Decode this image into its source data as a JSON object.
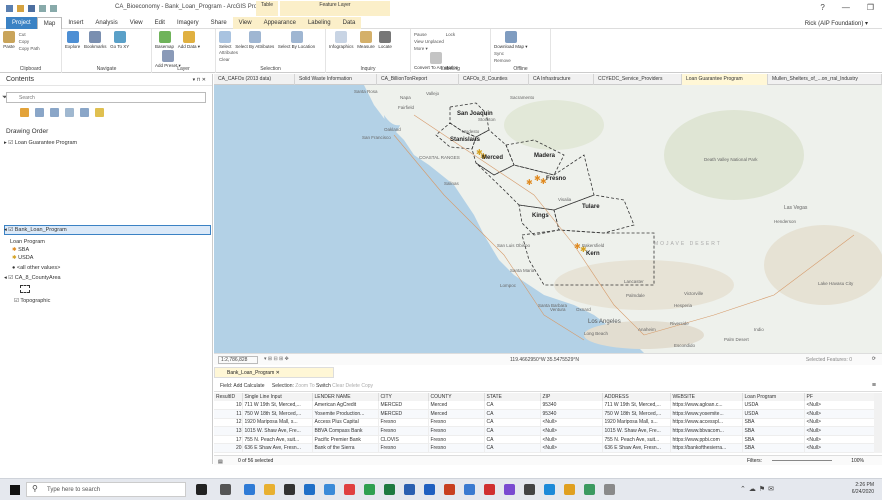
{
  "window": {
    "title": "CA_Bioeconomy - Bank_Loan_Program - ArcGIS Pro",
    "context_table": "Table",
    "context_feature": "Feature Layer",
    "help": "?",
    "minimize": "—",
    "restore": "❐",
    "user": "Rick (AIP Foundation) ▾"
  },
  "ribbon_tabs": [
    "Project",
    "Map",
    "Insert",
    "Analysis",
    "View",
    "Edit",
    "Imagery",
    "Share",
    "View",
    "Appearance",
    "Labeling",
    "Data"
  ],
  "ribbon_groups": [
    {
      "label": "Clipboard",
      "items": [
        "Cut",
        "Copy",
        "Copy Path"
      ],
      "paste": "Paste"
    },
    {
      "label": "Navigate",
      "items": [
        "Explore",
        "Bookmarks",
        "Go To XY"
      ]
    },
    {
      "label": "Layer",
      "items": [
        "Basemap",
        "Add Data ▾",
        "Add Preset ▾"
      ]
    },
    {
      "label": "Selection",
      "items": [
        "Select",
        "Select By Attributes",
        "Select By Location",
        "Attributes",
        "Clear"
      ]
    },
    {
      "label": "Inquiry",
      "items": [
        "Infographics",
        "Measure",
        "Locate"
      ]
    },
    {
      "label": "Labeling",
      "items": [
        "Pause",
        "Lock",
        "View Unplaced",
        "More ▾",
        "Convert To Annotation"
      ]
    },
    {
      "label": "Offline",
      "items": [
        "Download Map ▾",
        "Sync",
        "Remove"
      ]
    }
  ],
  "contents": {
    "header": "Contents",
    "pin": "▾ ⊓ ✕",
    "search_placeholder": "Search",
    "drawing_order": "Drawing Order",
    "layers": {
      "loan_guarantee": "Loan Guarantee Program",
      "bank_loan": "Bank_Loan_Program",
      "loan_program": "Loan Program",
      "sba": "SBA",
      "usda": "USDA",
      "other": "<all other values>",
      "county": "CA_8_CountyArea",
      "topographic": "Topographic"
    }
  },
  "map_tabs": [
    "CA_CAFOs (2013 data)",
    "Solid Waste Information",
    "CA_BillionTonReport",
    "CAFOs_8_Counties",
    "CA Infrastructure",
    "CCYEDC_Service_Providers",
    "Loan Guarantee Program",
    "Mullen_Shelters_of_...on_rral_Industry"
  ],
  "map_labels": {
    "counties": [
      "San Joaquin",
      "Stanislaus",
      "Merced",
      "Madera",
      "Fresno",
      "Tulare",
      "Kings",
      "Kern"
    ],
    "places": [
      "Santa Rosa",
      "Napa",
      "Vallejo",
      "Fairfield",
      "Sacramento",
      "Stockton",
      "Oakland",
      "San Francisco",
      "Modesto",
      "COASTAL RANGES",
      "Salinas",
      "Visalia",
      "San Luis Obispo",
      "Bakersfield",
      "Santa Maria",
      "Lompoc",
      "Santa Barbara",
      "Oxnard",
      "Los Angeles",
      "Long Beach",
      "Anaheim",
      "Riverside",
      "Palm Desert",
      "Palmdale",
      "Lancaster",
      "Victorville",
      "Las Vegas",
      "Henderson",
      "Lake Havasu City",
      "Hesperia",
      "MOJAVE DESERT",
      "Death Valley National Park",
      "Ventura",
      "Indio",
      "Escondido"
    ]
  },
  "map_status": {
    "scale": "1:2,786,828",
    "coordinates": "119.4662950°W 35.5475529°N",
    "selected_features": "Selected Features: 0"
  },
  "attribute": {
    "tab": "Bank_Loan_Program ✕",
    "field_label": "Field:",
    "add": "Add",
    "calculate": "Calculate",
    "selection_label": "Selection:",
    "zoom_to": "Zoom To",
    "switch": "Switch",
    "clear": "Clear",
    "delete": "Delete",
    "copy": "Copy",
    "columns": [
      "ResultID",
      "Single Line Input",
      "LENDER NAME",
      "CITY",
      "COUNTY",
      "STATE",
      "ZIP",
      "ADDRESS",
      "WEBSITE",
      "Loan Program",
      "PF"
    ],
    "rows": [
      [
        "10",
        "711 W 19th St, Merced,...",
        "American AgCredit",
        "MERCED",
        "Merced",
        "CA",
        "95340",
        "711 W 19th St, Merced,...",
        "https://www.agloan.c...",
        "USDA",
        "<Null>"
      ],
      [
        "11",
        "750 W 18th St, Merced,...",
        "Yosemite Production...",
        "MERCED",
        "Merced",
        "CA",
        "95340",
        "750 W 18th St, Merced,...",
        "https://www.yosemite...",
        "USDA",
        "<Null>"
      ],
      [
        "12",
        "1920 Mariposa Mall, s...",
        "Access Plus Capital",
        "Fresno",
        "Fresno",
        "CA",
        "<Null>",
        "1920 Mariposa Mall, s...",
        "https://www.accesspl...",
        "SBA",
        "<Null>"
      ],
      [
        "13",
        "1015 W. Shaw Ave, Fre...",
        "BBVA Compass Bank",
        "Fresno",
        "Fresno",
        "CA",
        "<Null>",
        "1015 W. Shaw Ave, Fre...",
        "https://www.bbvacom...",
        "SBA",
        "<Null>"
      ],
      [
        "17",
        "755 N. Peach Ave, suit...",
        "Pacific Premier Bank",
        "CLOVIS",
        "Fresno",
        "CA",
        "<Null>",
        "755 N. Peach Ave, suit...",
        "https://www.ppbi.com",
        "SBA",
        "<Null>"
      ],
      [
        "20",
        "636 E Shaw Ave, Fresn...",
        "Bank of the Sierra",
        "Fresno",
        "Fresno",
        "CA",
        "<Null>",
        "636 E Shaw Ave, Fresn...",
        "https://bankofthesierra...",
        "SBA",
        "<Null>"
      ]
    ],
    "footer": "0 of 56 selected",
    "filters": "Filters:",
    "zoom": "100%"
  },
  "taskbar": {
    "search_placeholder": "Type here to search",
    "time": "2:26 PM",
    "date": "6/24/2020"
  },
  "colors": {
    "project_tab": "#3b82c4",
    "context_tab": "#fbefc9",
    "map_land": "#eef1ec",
    "water": "#b3d1e6",
    "county_outline": "#333333"
  }
}
